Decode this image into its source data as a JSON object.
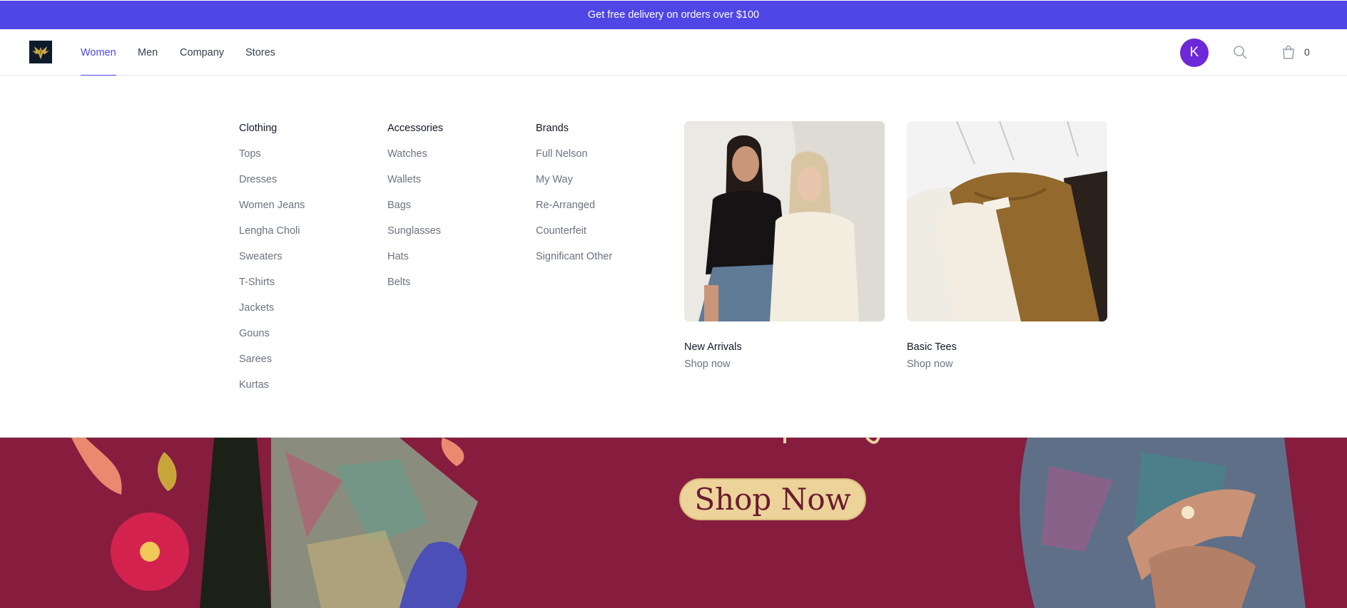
{
  "promo": {
    "text": "Get free delivery on orders over $100"
  },
  "nav": {
    "items": [
      {
        "label": "Women",
        "active": true
      },
      {
        "label": "Men"
      },
      {
        "label": "Company"
      },
      {
        "label": "Stores"
      }
    ],
    "avatar_initial": "K",
    "cart_count": "0",
    "icons": [
      "eagle-logo",
      "search-icon",
      "shopping-bag-icon"
    ]
  },
  "mega_menu": {
    "columns": [
      {
        "title": "Clothing",
        "items": [
          "Tops",
          "Dresses",
          "Women Jeans",
          "Lengha Choli",
          "Sweaters",
          "T-Shirts",
          "Jackets",
          "Gouns",
          "Sarees",
          "Kurtas"
        ]
      },
      {
        "title": "Accessories",
        "items": [
          "Watches",
          "Wallets",
          "Bags",
          "Sunglasses",
          "Hats",
          "Belts"
        ]
      },
      {
        "title": "Brands",
        "items": [
          "Full Nelson",
          "My Way",
          "Re-Arranged",
          "Counterfeit",
          "Significant Other"
        ]
      }
    ],
    "features": [
      {
        "title": "New Arrivals",
        "link": "Shop now"
      },
      {
        "title": "Basic Tees",
        "link": "Shop now"
      }
    ]
  },
  "hero": {
    "cta": "Shop Now"
  },
  "colors": {
    "accent": "#4f46e5",
    "avatar": "#6d28d9",
    "hero_background": "#861c3e",
    "cta_background": "#ecd39a"
  }
}
